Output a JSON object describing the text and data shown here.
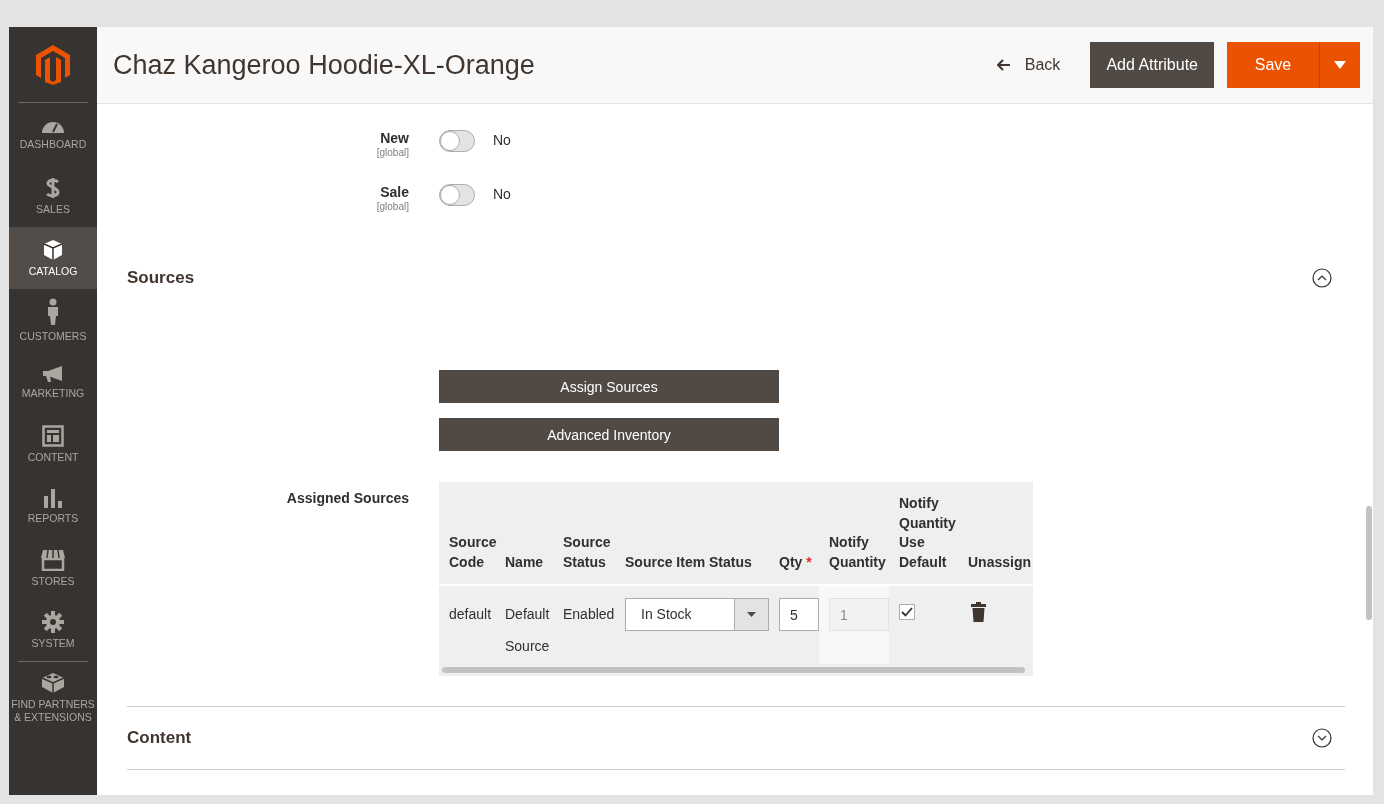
{
  "sidebar": {
    "items": [
      {
        "label": "DASHBOARD",
        "kind": "dashboard",
        "selected": false
      },
      {
        "label": "SALES",
        "kind": "sales",
        "selected": false
      },
      {
        "label": "CATALOG",
        "kind": "catalog",
        "selected": true
      },
      {
        "label": "CUSTOMERS",
        "kind": "customers",
        "selected": false
      },
      {
        "label": "MARKETING",
        "kind": "marketing",
        "selected": false
      },
      {
        "label": "CONTENT",
        "kind": "content",
        "selected": false
      },
      {
        "label": "REPORTS",
        "kind": "reports",
        "selected": false
      },
      {
        "label": "STORES",
        "kind": "stores",
        "selected": false
      },
      {
        "label": "SYSTEM",
        "kind": "system",
        "selected": false
      },
      {
        "label": "FIND PARTNERS & EXTENSIONS",
        "kind": "partners",
        "selected": false
      }
    ]
  },
  "page_title": "Chaz Kangeroo Hoodie-XL-Orange",
  "header_actions": {
    "back": "Back",
    "add_attribute": "Add Attribute",
    "save": "Save"
  },
  "attributes": [
    {
      "label": "New",
      "scope": "[global]",
      "on": false,
      "value": "No"
    },
    {
      "label": "Sale",
      "scope": "[global]",
      "on": false,
      "value": "No"
    }
  ],
  "sources_section": {
    "title": "Sources",
    "expanded": true,
    "buttons": [
      "Assign Sources",
      "Advanced Inventory"
    ],
    "assigned_label": "Assigned Sources",
    "table": {
      "columns": [
        {
          "label": "Source Code"
        },
        {
          "label": "Name"
        },
        {
          "label": "Source Status"
        },
        {
          "label": "Source Item Status"
        },
        {
          "label": "Qty",
          "required_mark": "*"
        },
        {
          "label": "Notify Quantity"
        },
        {
          "label": "Notify Quantity Use Default"
        },
        {
          "label": "Unassign"
        }
      ],
      "rows": [
        {
          "source_code": "default",
          "name": "Default Source",
          "source_status": "Enabled",
          "source_item_status": "In Stock",
          "qty": "5",
          "notify_quantity": "1",
          "use_default": true
        }
      ]
    }
  },
  "collapsed_sections": [
    {
      "title": "Content",
      "expanded": false
    }
  ]
}
